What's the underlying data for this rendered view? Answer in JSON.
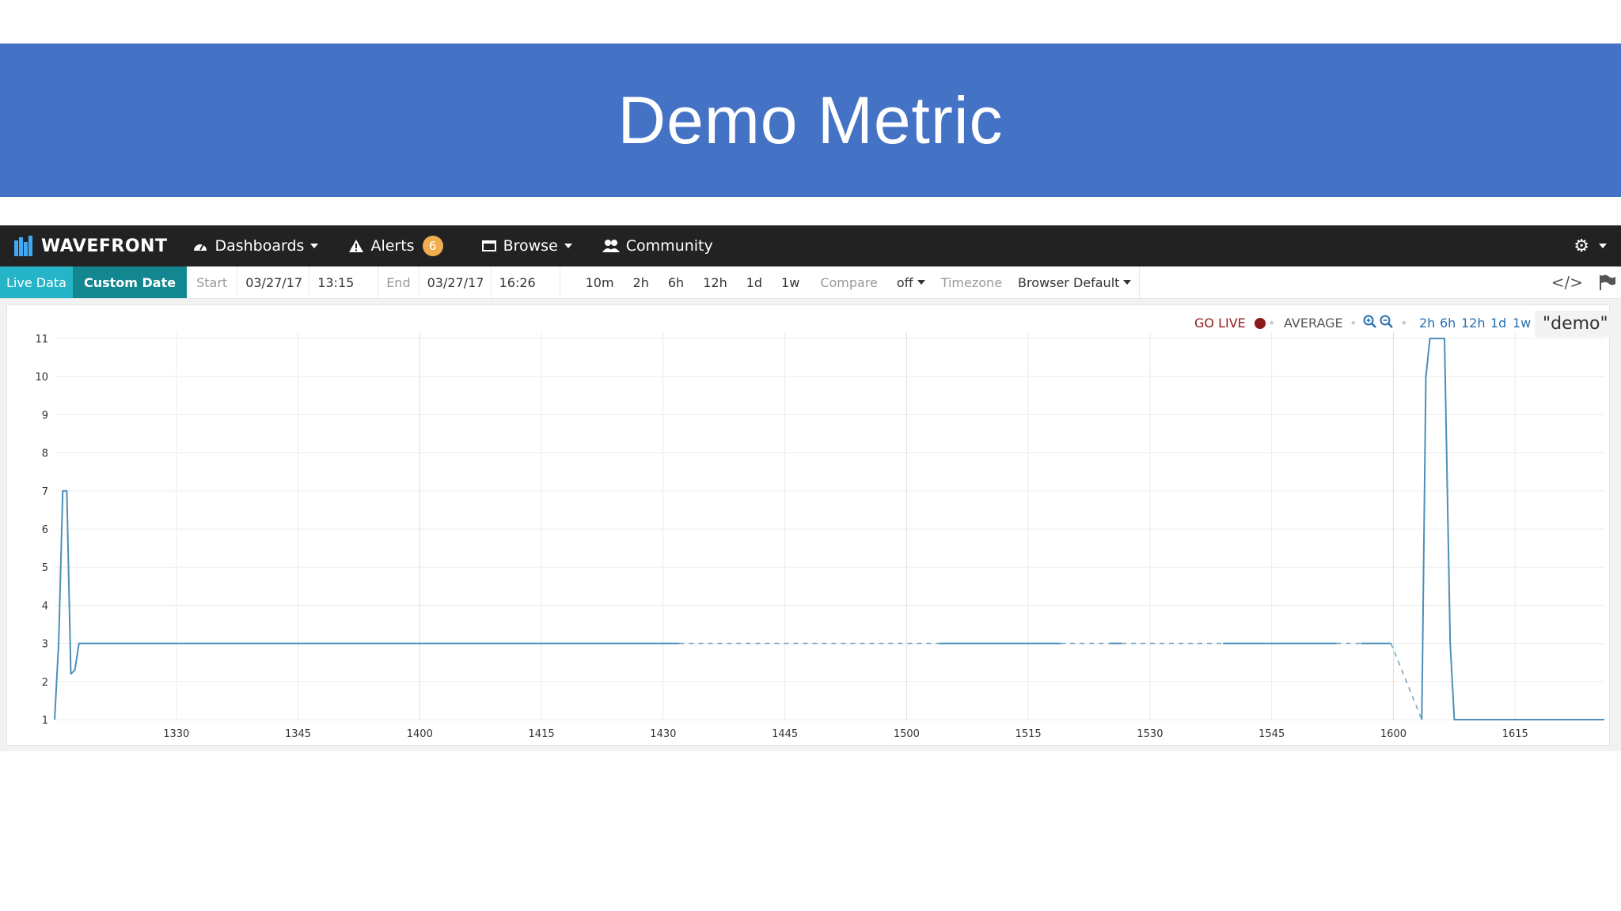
{
  "slide": {
    "title": "Demo Metric"
  },
  "navbar": {
    "brand": "WAVEFRONT",
    "dashboards": "Dashboards",
    "alerts": "Alerts",
    "alerts_count": "6",
    "browse": "Browse",
    "community": "Community"
  },
  "toolbar": {
    "live_data": "Live Data",
    "custom_date": "Custom Date",
    "start_label": "Start",
    "start_date": "03/27/17",
    "start_time": "13:15",
    "end_label": "End",
    "end_date": "03/27/17",
    "end_time": "16:26",
    "ranges": [
      "10m",
      "2h",
      "6h",
      "12h",
      "1d",
      "1w"
    ],
    "compare_label": "Compare",
    "compare_value": "off",
    "timezone_label": "Timezone",
    "timezone_value": "Browser Default"
  },
  "chart_controls": {
    "go_live": "GO LIVE",
    "aggregation": "AVERAGE",
    "ranges": [
      "2h",
      "6h",
      "12h",
      "1d",
      "1w"
    ],
    "query_label": "\"demo\""
  },
  "colors": {
    "title_band": "#4472c4",
    "navbar": "#222222",
    "live_data": "#26b5c8",
    "custom_date": "#12878f",
    "alert_badge": "#f0ad4e",
    "series": "#4d8fb8",
    "go_live": "#8b1a1a",
    "link": "#2a6fb0"
  },
  "chart_data": {
    "type": "line",
    "x_unit": "HHMM",
    "xlim": [
      "13:15",
      "16:26"
    ],
    "ylim": [
      1,
      11
    ],
    "x_ticks": [
      "1330",
      "1345",
      "1400",
      "1415",
      "1430",
      "1445",
      "1500",
      "1515",
      "1530",
      "1545",
      "1600",
      "1615"
    ],
    "y_ticks": [
      "1",
      "2",
      "3",
      "4",
      "5",
      "6",
      "7",
      "8",
      "9",
      "10",
      "11"
    ],
    "grid": true,
    "series": [
      {
        "style": "solid",
        "points": [
          [
            "13:15",
            1
          ],
          [
            "13:15.5",
            3
          ],
          [
            "13:16",
            7
          ],
          [
            "13:16.5",
            7
          ],
          [
            "13:17",
            2.2
          ],
          [
            "13:17.5",
            2.3
          ],
          [
            "13:18",
            3
          ],
          [
            "14:32",
            3
          ]
        ]
      },
      {
        "style": "dashed",
        "points": [
          [
            "14:32",
            3
          ],
          [
            "15:04",
            3
          ]
        ]
      },
      {
        "style": "solid",
        "points": [
          [
            "15:04",
            3
          ],
          [
            "15:19",
            3
          ]
        ]
      },
      {
        "style": "dashed",
        "points": [
          [
            "15:19",
            3
          ],
          [
            "15:25",
            3
          ]
        ]
      },
      {
        "style": "solid",
        "points": [
          [
            "15:25",
            3
          ],
          [
            "15:26.5",
            3
          ]
        ]
      },
      {
        "style": "dashed",
        "points": [
          [
            "15:26.5",
            3
          ],
          [
            "15:39",
            3
          ]
        ]
      },
      {
        "style": "solid",
        "points": [
          [
            "15:39",
            3
          ],
          [
            "15:53",
            3
          ]
        ]
      },
      {
        "style": "dashed",
        "points": [
          [
            "15:53",
            3
          ],
          [
            "15:56",
            3
          ]
        ]
      },
      {
        "style": "solid",
        "points": [
          [
            "15:56",
            3
          ],
          [
            "15:59.7",
            3
          ]
        ]
      },
      {
        "style": "dashed",
        "points": [
          [
            "15:59.7",
            3
          ],
          [
            "16:03.5",
            1
          ]
        ]
      },
      {
        "style": "solid",
        "points": [
          [
            "16:03.5",
            1
          ],
          [
            "16:04",
            10
          ],
          [
            "16:04.5",
            11
          ],
          [
            "16:06.3",
            11
          ],
          [
            "16:07",
            3
          ],
          [
            "16:07.5",
            1
          ],
          [
            "16:26",
            1
          ]
        ]
      }
    ]
  }
}
